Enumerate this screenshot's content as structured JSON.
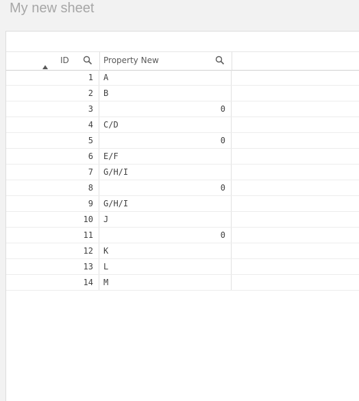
{
  "sheet": {
    "title": "My new sheet"
  },
  "table": {
    "columns": [
      {
        "label": "ID",
        "sorted": "ascending",
        "search_icon": "search-icon"
      },
      {
        "label": "Property New",
        "search_icon": "search-icon"
      }
    ],
    "rows": [
      {
        "id": "1",
        "property": "A"
      },
      {
        "id": "2",
        "property": "B"
      },
      {
        "id": "3",
        "property": "0"
      },
      {
        "id": "4",
        "property": "C/D"
      },
      {
        "id": "5",
        "property": "0"
      },
      {
        "id": "6",
        "property": "E/F"
      },
      {
        "id": "7",
        "property": "G/H/I"
      },
      {
        "id": "8",
        "property": "0"
      },
      {
        "id": "9",
        "property": "G/H/I"
      },
      {
        "id": "10",
        "property": "J"
      },
      {
        "id": "11",
        "property": "0"
      },
      {
        "id": "12",
        "property": "K"
      },
      {
        "id": "13",
        "property": "L"
      },
      {
        "id": "14",
        "property": "M"
      }
    ]
  }
}
